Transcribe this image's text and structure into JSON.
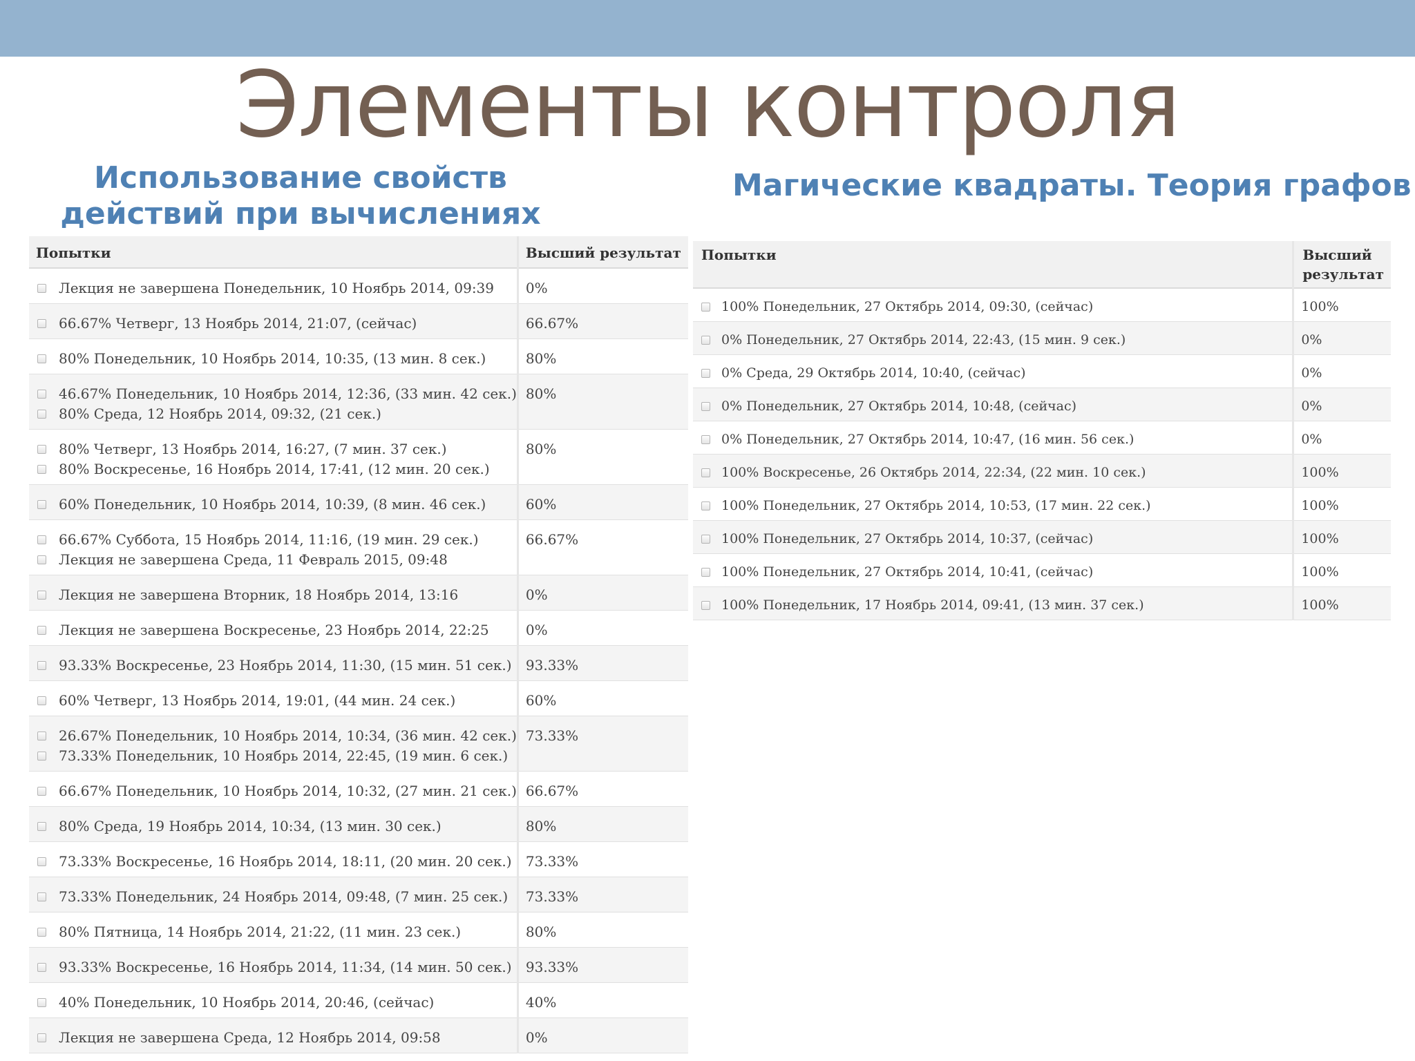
{
  "slide": {
    "title": "Элементы контроля",
    "left_section_title": "Использование свойств действий при вычислениях",
    "right_section_title": "Магические квадраты. Теория графов"
  },
  "left_table": {
    "col_attempts": "Попытки",
    "col_best": "Высший результат",
    "rows": [
      {
        "attempts": [
          "Лекция не завершена Понедельник, 10 Ноябрь 2014, 09:39"
        ],
        "best": "0%"
      },
      {
        "attempts": [
          "66.67% Четверг, 13 Ноябрь 2014, 21:07, (сейчас)"
        ],
        "best": "66.67%"
      },
      {
        "attempts": [
          "80% Понедельник, 10 Ноябрь 2014, 10:35, (13 мин. 8 сек.)"
        ],
        "best": "80%"
      },
      {
        "attempts": [
          "46.67% Понедельник, 10 Ноябрь 2014, 12:36, (33 мин. 42 сек.)",
          "80% Среда, 12 Ноябрь 2014, 09:32, (21 сек.)"
        ],
        "best": "80%"
      },
      {
        "attempts": [
          "80% Четверг, 13 Ноябрь 2014, 16:27, (7 мин. 37 сек.)",
          "80% Воскресенье, 16 Ноябрь 2014, 17:41, (12 мин. 20 сек.)"
        ],
        "best": "80%"
      },
      {
        "attempts": [
          "60% Понедельник, 10 Ноябрь 2014, 10:39, (8 мин. 46 сек.)"
        ],
        "best": "60%"
      },
      {
        "attempts": [
          "66.67% Суббота, 15 Ноябрь 2014, 11:16, (19 мин. 29 сек.)",
          "Лекция не завершена Среда, 11 Февраль 2015, 09:48"
        ],
        "best": "66.67%"
      },
      {
        "attempts": [
          "Лекция не завершена Вторник, 18 Ноябрь 2014, 13:16"
        ],
        "best": "0%"
      },
      {
        "attempts": [
          "Лекция не завершена Воскресенье, 23 Ноябрь 2014, 22:25"
        ],
        "best": "0%"
      },
      {
        "attempts": [
          "93.33% Воскресенье, 23 Ноябрь 2014, 11:30, (15 мин. 51 сек.)"
        ],
        "best": "93.33%"
      },
      {
        "attempts": [
          "60% Четверг, 13 Ноябрь 2014, 19:01, (44 мин. 24 сек.)"
        ],
        "best": "60%"
      },
      {
        "attempts": [
          "26.67% Понедельник, 10 Ноябрь 2014, 10:34, (36 мин. 42 сек.)",
          "73.33% Понедельник, 10 Ноябрь 2014, 22:45, (19 мин. 6 сек.)"
        ],
        "best": "73.33%"
      },
      {
        "attempts": [
          "66.67% Понедельник, 10 Ноябрь 2014, 10:32, (27 мин. 21 сек.)"
        ],
        "best": "66.67%"
      },
      {
        "attempts": [
          "80% Среда, 19 Ноябрь 2014, 10:34, (13 мин. 30 сек.)"
        ],
        "best": "80%"
      },
      {
        "attempts": [
          "73.33% Воскресенье, 16 Ноябрь 2014, 18:11, (20 мин. 20 сек.)"
        ],
        "best": "73.33%"
      },
      {
        "attempts": [
          "73.33% Понедельник, 24 Ноябрь 2014, 09:48, (7 мин. 25 сек.)"
        ],
        "best": "73.33%"
      },
      {
        "attempts": [
          "80% Пятница, 14 Ноябрь 2014, 21:22, (11 мин. 23 сек.)"
        ],
        "best": "80%"
      },
      {
        "attempts": [
          "93.33% Воскресенье, 16 Ноябрь 2014, 11:34, (14 мин. 50 сек.)"
        ],
        "best": "93.33%"
      },
      {
        "attempts": [
          "40% Понедельник, 10 Ноябрь 2014, 20:46, (сейчас)"
        ],
        "best": "40%"
      },
      {
        "attempts": [
          "Лекция не завершена Среда, 12 Ноябрь 2014, 09:58"
        ],
        "best": "0%"
      }
    ]
  },
  "right_table": {
    "col_attempts": "Попытки",
    "col_best": "Высший результат",
    "rows": [
      {
        "attempts": [
          "100% Понедельник, 27 Октябрь 2014, 09:30, (сейчас)"
        ],
        "best": "100%"
      },
      {
        "attempts": [
          "0% Понедельник, 27 Октябрь 2014, 22:43, (15 мин. 9 сек.)"
        ],
        "best": "0%"
      },
      {
        "attempts": [
          "0% Среда, 29 Октябрь 2014, 10:40, (сейчас)"
        ],
        "best": "0%"
      },
      {
        "attempts": [
          "0% Понедельник, 27 Октябрь 2014, 10:48, (сейчас)"
        ],
        "best": "0%"
      },
      {
        "attempts": [
          "0% Понедельник, 27 Октябрь 2014, 10:47, (16 мин. 56 сек.)"
        ],
        "best": "0%"
      },
      {
        "attempts": [
          "100% Воскресенье, 26 Октябрь 2014, 22:34, (22 мин. 10 сек.)"
        ],
        "best": "100%"
      },
      {
        "attempts": [
          "100% Понедельник, 27 Октябрь 2014, 10:53, (17 мин. 22 сек.)"
        ],
        "best": "100%"
      },
      {
        "attempts": [
          "100% Понедельник, 27 Октябрь 2014, 10:37, (сейчас)"
        ],
        "best": "100%"
      },
      {
        "attempts": [
          "100% Понедельник, 27 Октябрь 2014, 10:41, (сейчас)"
        ],
        "best": "100%"
      },
      {
        "attempts": [
          "100% Понедельник, 17 Ноябрь 2014, 09:41, (13 мин. 37 сек.)"
        ],
        "best": "100%"
      }
    ]
  }
}
